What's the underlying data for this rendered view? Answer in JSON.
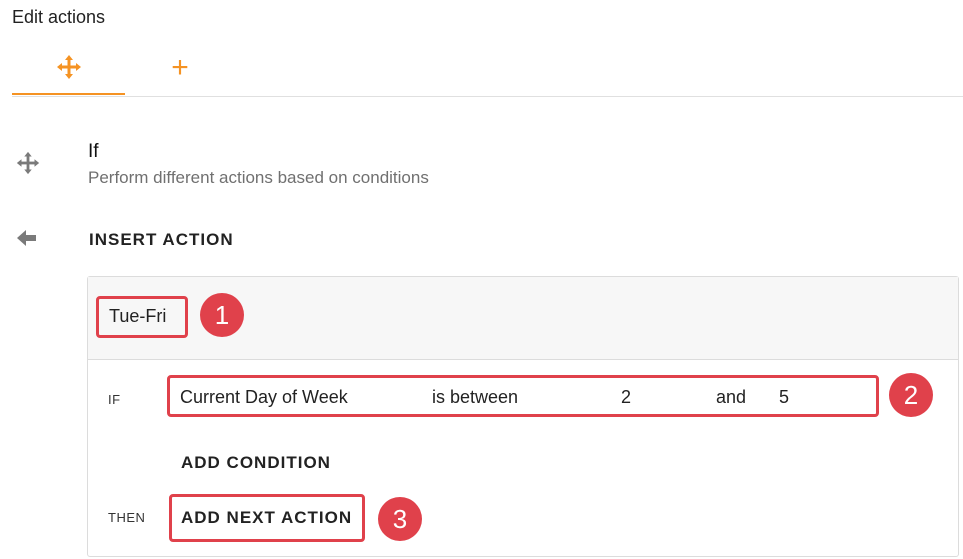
{
  "header": {
    "title": "Edit actions"
  },
  "tabs": [
    {
      "icon": "flow-split-icon",
      "active": true
    },
    {
      "icon": "plus-icon",
      "label": "+"
    }
  ],
  "action": {
    "title": "If",
    "description": "Perform different actions based on conditions",
    "insert_label": "INSERT ACTION"
  },
  "card": {
    "name": "Tue-Fri",
    "if_label": "IF",
    "condition": {
      "field": "Current Day of Week",
      "operator": "is between",
      "value1": "2",
      "connector": "and",
      "value2": "5"
    },
    "add_condition_label": "ADD CONDITION",
    "then_label": "THEN",
    "add_next_label": "ADD NEXT ACTION"
  },
  "annotations": [
    "1",
    "2",
    "3"
  ],
  "colors": {
    "accent": "#f59323",
    "highlight": "#e0414b",
    "muted_icon": "#7a7a7a"
  }
}
